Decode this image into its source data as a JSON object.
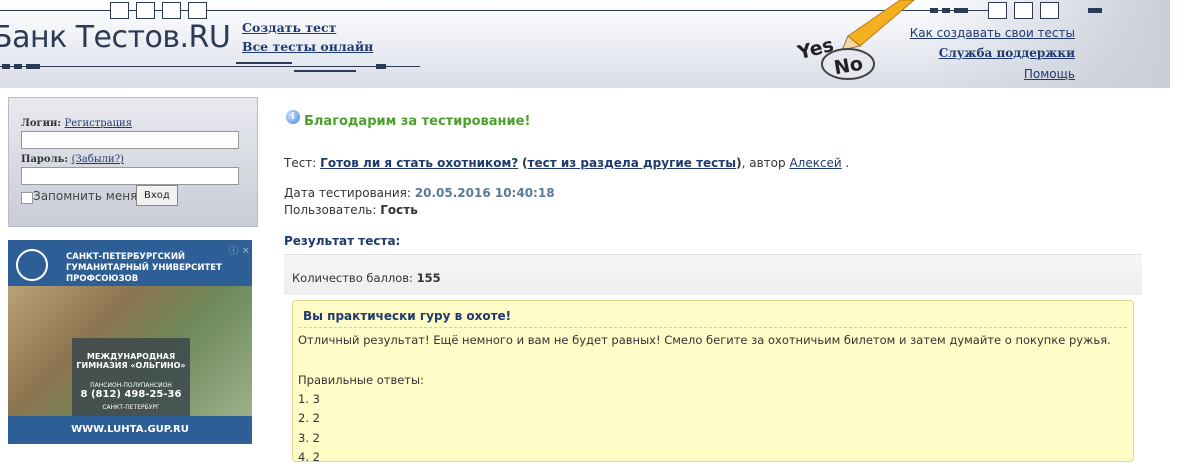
{
  "header": {
    "logo": "Банк Тестов.RU",
    "nav": [
      {
        "label": "Создать тест"
      },
      {
        "label": "Все тесты онлайн"
      }
    ],
    "yes": "Yes",
    "no": "No",
    "right_links": [
      {
        "label": "Как создавать свои тесты"
      },
      {
        "label": "Служба поддержки"
      },
      {
        "label": "Помощь"
      }
    ],
    "colors": {
      "brand": "#2b3a55",
      "link": "#1f3a6e"
    }
  },
  "login": {
    "login_label": "Логин:",
    "register_link": "Регистрация",
    "password_label": "Пароль:",
    "forgot_link": "(Забыли?)",
    "remember_label": "Запомнить меня",
    "submit_label": "Вход"
  },
  "ad": {
    "title": "Санкт-Петербургский гуманитарный университет профсоюзов",
    "line1": "Международная",
    "line2": "гимназия «Ольгино»",
    "line3": "пансион-полупансион",
    "phone": "8 (812) 498-25-36",
    "city": "Санкт-Петербург",
    "url": "WWW.LUHTA.GUP.RU"
  },
  "result": {
    "thanks": "Благодарим за тестирование!",
    "test_prefix": "Тест:",
    "test_name": "Готов ли я стать охотником?",
    "section_link": "тест из раздела другие тесты",
    "author_prefix": ", автор",
    "author": "Алексей",
    "date_label": "Дата тестирования:",
    "date_value": "20.05.2016 10:40:18",
    "user_label": "Пользователь:",
    "user_value": "Гость",
    "result_heading": "Результат теста:",
    "score_label": "Количество баллов:",
    "score_value": "155",
    "verdict_title": "Вы практически гуру в охоте!",
    "verdict_text": "Отличный результат! Ещё немного и вам не будет равных! Смело бегите за охотничьим билетом и затем думайте о покупке ружья.",
    "answers_heading": "Правильные ответы:",
    "answers": [
      "1. 3",
      "2. 2",
      "3. 2",
      "4. 2"
    ]
  }
}
